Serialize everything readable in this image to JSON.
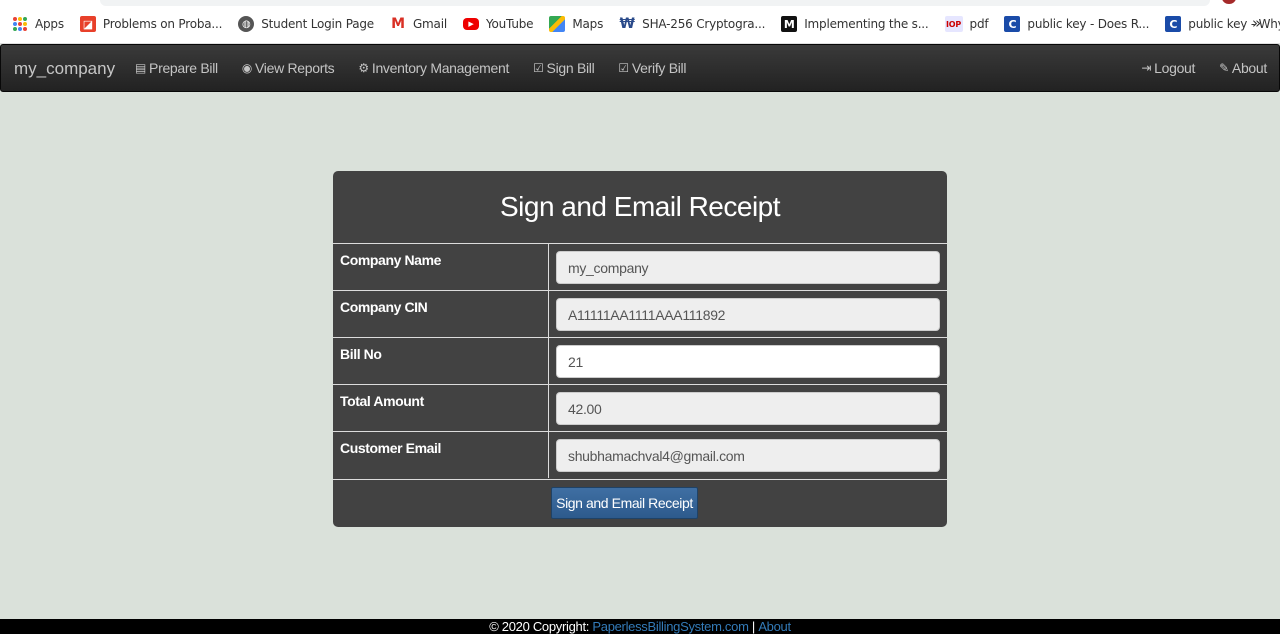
{
  "bookmarks": [
    {
      "icon": "apps-icon",
      "label": "Apps"
    },
    {
      "icon": "problems-icon",
      "label": "Problems on Proba..."
    },
    {
      "icon": "globe-icon",
      "label": "Student Login Page"
    },
    {
      "icon": "gmail-icon",
      "label": "Gmail"
    },
    {
      "icon": "youtube-icon",
      "label": "YouTube"
    },
    {
      "icon": "maps-icon",
      "label": "Maps"
    },
    {
      "icon": "sha-icon",
      "label": "SHA-256 Cryptogra..."
    },
    {
      "icon": "medium-icon",
      "label": "Implementing the s..."
    },
    {
      "icon": "iop-icon",
      "label": "pdf"
    },
    {
      "icon": "stackexchange-icon",
      "label": "public key - Does R..."
    },
    {
      "icon": "stackexchange-icon",
      "label": "public key - Why d..."
    }
  ],
  "bookmarks_more": "»",
  "navbar": {
    "brand": "my_company",
    "links": [
      {
        "icon": "list-icon",
        "label": "Prepare Bill"
      },
      {
        "icon": "eye-icon",
        "label": "View Reports"
      },
      {
        "icon": "gear-icon",
        "label": "Inventory Management"
      },
      {
        "icon": "check-edit-icon",
        "label": "Sign Bill"
      },
      {
        "icon": "check-edit-icon",
        "label": "Verify Bill"
      }
    ],
    "right_links": [
      {
        "icon": "logout-icon",
        "label": "Logout"
      },
      {
        "icon": "edit-icon",
        "label": "About"
      }
    ]
  },
  "form": {
    "title": "Sign and Email Receipt",
    "rows": [
      {
        "label": "Company Name",
        "value": "my_company",
        "editable": false
      },
      {
        "label": "Company CIN",
        "value": "A11111AA1111AAA111892",
        "editable": false
      },
      {
        "label": "Bill No",
        "value": "21",
        "editable": true
      },
      {
        "label": "Total Amount",
        "value": "42.00",
        "editable": false
      },
      {
        "label": "Customer Email",
        "value": "shubhamachval4@gmail.com",
        "editable": false
      }
    ],
    "submit_label": "Sign and Email Receipt"
  },
  "footer": {
    "copyright": "© 2020 Copyright:",
    "site_link": "PaperlessBillingSystem.com",
    "separator": "|",
    "about_link": "About"
  },
  "colors": {
    "page_bg": "#dae1da",
    "navbar_bg": "#222222",
    "card_bg": "#424242",
    "button_bg": "#3a6a9c",
    "link": "#337ab7"
  }
}
